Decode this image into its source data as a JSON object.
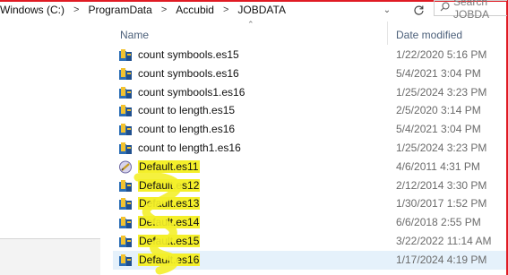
{
  "breadcrumb": {
    "items": [
      "Windows (C:)",
      "ProgramData",
      "Accubid",
      "JOBDATA"
    ],
    "separator": ">"
  },
  "search": {
    "placeholder": "Search JOBDA"
  },
  "columns": {
    "name": "Name",
    "date_modified": "Date modified"
  },
  "files": [
    {
      "name": "count symbools.es15",
      "date": "1/22/2020 5:16 PM",
      "icon": "accubid-file-icon",
      "highlighted": false
    },
    {
      "name": "count symbools.es16",
      "date": "5/4/2021 3:04 PM",
      "icon": "accubid-file-icon",
      "highlighted": false
    },
    {
      "name": "count symbools1.es16",
      "date": "1/25/2024 3:23 PM",
      "icon": "accubid-file-icon",
      "highlighted": false
    },
    {
      "name": "count to length.es15",
      "date": "2/5/2020 3:14 PM",
      "icon": "accubid-file-icon",
      "highlighted": false
    },
    {
      "name": "count to length.es16",
      "date": "5/4/2021 3:04 PM",
      "icon": "accubid-file-icon",
      "highlighted": false
    },
    {
      "name": "count to length1.es16",
      "date": "1/25/2024 3:23 PM",
      "icon": "accubid-file-icon",
      "highlighted": false
    },
    {
      "name": "Default.es11",
      "date": "4/6/2011 4:31 PM",
      "icon": "legacy-file-icon",
      "highlighted": true
    },
    {
      "name": "Default.es12",
      "date": "2/12/2014 3:30 PM",
      "icon": "accubid-file-icon",
      "highlighted": true
    },
    {
      "name": "Default.es13",
      "date": "1/30/2017 1:52 PM",
      "icon": "accubid-file-icon",
      "highlighted": true
    },
    {
      "name": "Default.es14",
      "date": "6/6/2018 2:55 PM",
      "icon": "accubid-file-icon",
      "highlighted": true
    },
    {
      "name": "Default.es15",
      "date": "3/22/2022 11:14 AM",
      "icon": "accubid-file-icon",
      "highlighted": true
    },
    {
      "name": "Default.es16",
      "date": "1/17/2024 4:19 PM",
      "icon": "accubid-file-icon",
      "highlighted": true,
      "selected": true
    }
  ],
  "colors": {
    "highlight": "#f4ef2a",
    "selected_row": "#e5f1fb",
    "header_text": "#4c607a",
    "frame": "#e01b24"
  }
}
